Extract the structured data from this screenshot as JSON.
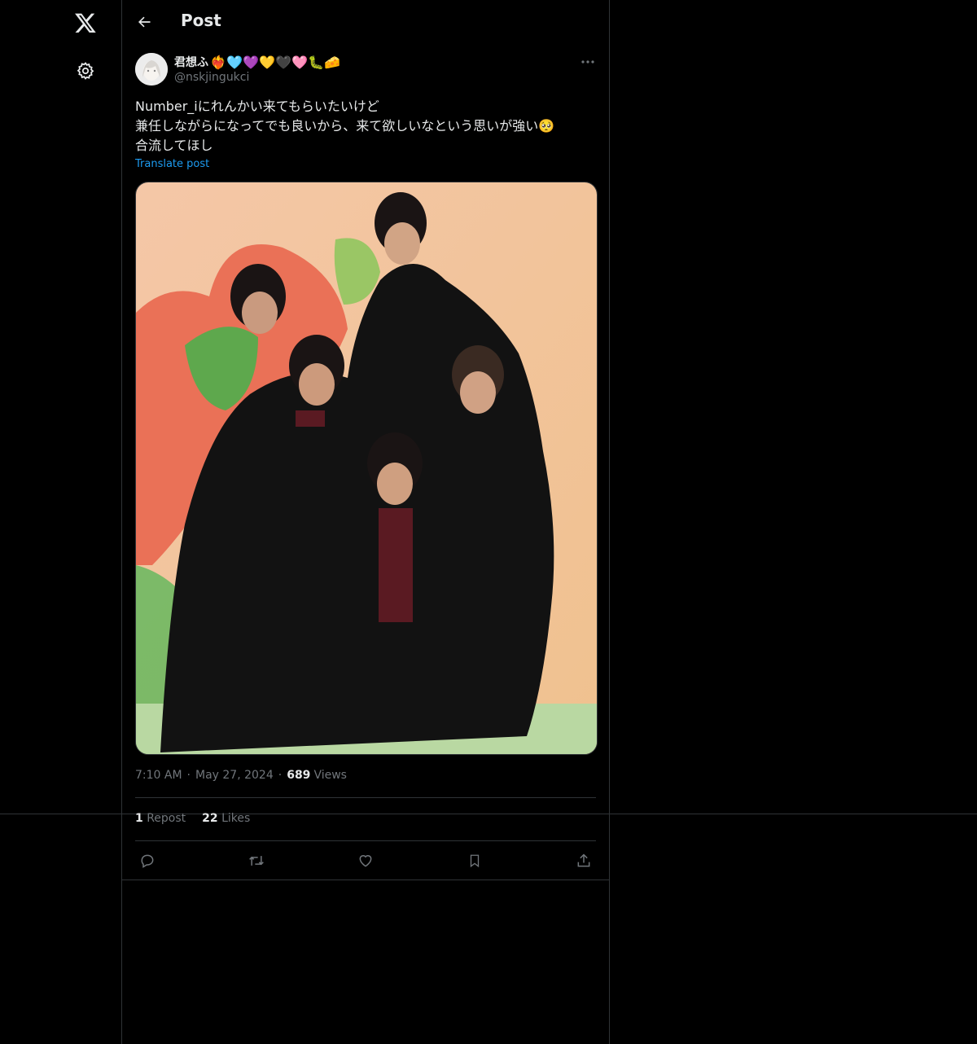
{
  "header": {
    "title": "Post"
  },
  "author": {
    "display_name": "君想ふ",
    "name_emojis": [
      "❤️‍🔥",
      "🩵",
      "💜",
      "💛",
      "🖤",
      "🩷",
      "🐛",
      "🧀"
    ],
    "handle": "@nskjingukci"
  },
  "post": {
    "lines": [
      "Number_iにれんかい来てもらいたいけど",
      "兼任しながらになってでも良いから、来て欲しいなという思いが強い🥺",
      "合流してほし"
    ],
    "translate_label": "Translate post",
    "time": "7:10 AM",
    "date": "May 27, 2024",
    "views_count": "689",
    "views_label": "Views",
    "reposts_count": "1",
    "reposts_label": "Repost",
    "likes_count": "22",
    "likes_label": "Likes"
  },
  "icons": {
    "logo": "x-logo-icon",
    "settings": "gear-icon",
    "back": "arrow-left-icon",
    "more": "more-horizontal-icon",
    "reply": "reply-icon",
    "repost": "repost-icon",
    "like": "heart-icon",
    "bookmark": "bookmark-icon",
    "share": "share-icon"
  },
  "colors": {
    "background": "#000000",
    "text": "#e7e9ea",
    "muted": "#71767b",
    "link": "#1d9bf0",
    "border": "#2f3336"
  }
}
